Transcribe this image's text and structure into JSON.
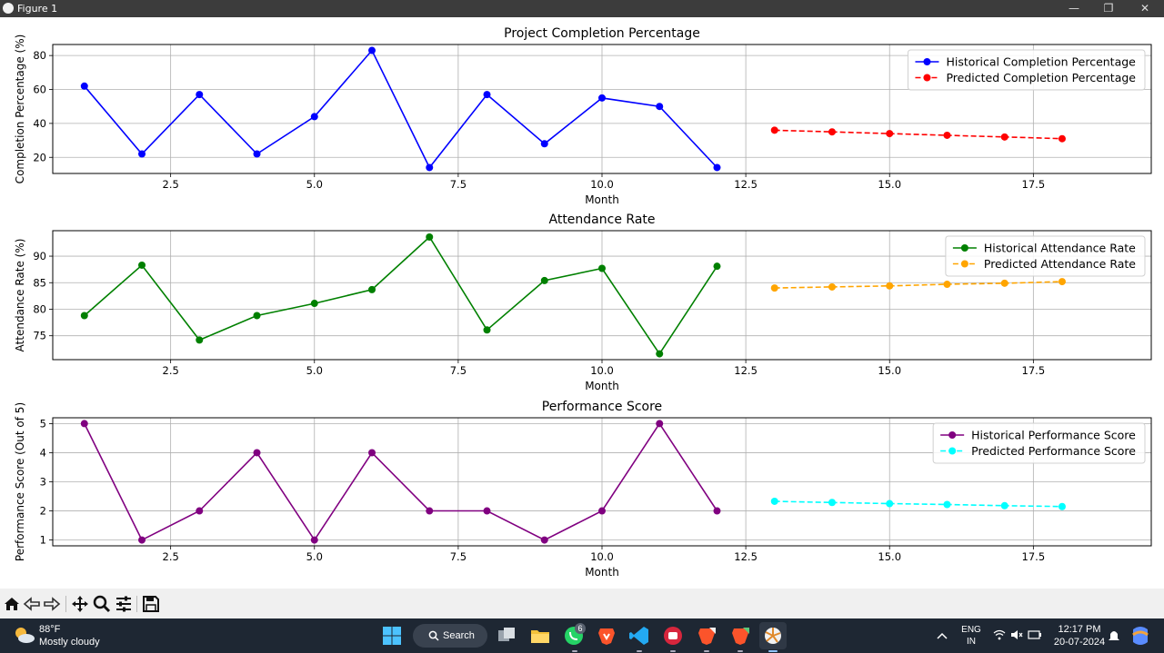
{
  "window": {
    "title": "Figure 1",
    "minimize_glyph": "—",
    "maximize_glyph": "❐",
    "close_glyph": "✕"
  },
  "charts": [
    {
      "title": "Project Completion Percentage",
      "xlabel": "Month",
      "ylabel": "Completion Percentage (%)",
      "xlim": [
        0.45,
        19.55
      ],
      "ylim": [
        10.5,
        86.5
      ],
      "xticks": [
        2.5,
        5.0,
        7.5,
        10.0,
        12.5,
        15.0,
        17.5
      ],
      "xtick_labels": [
        "2.5",
        "5.0",
        "7.5",
        "10.0",
        "12.5",
        "15.0",
        "17.5"
      ],
      "yticks": [
        20,
        40,
        60,
        80
      ],
      "ytick_labels": [
        "20",
        "40",
        "60",
        "80"
      ],
      "legend_position": "upper-right",
      "series": [
        {
          "name": "Historical Completion Percentage",
          "color": "#0000ff",
          "style": "solid",
          "x": [
            1,
            2,
            3,
            4,
            5,
            6,
            7,
            8,
            9,
            10,
            11,
            12
          ],
          "values": [
            62,
            22,
            57,
            22,
            44,
            83,
            14,
            57,
            28,
            55,
            50,
            14
          ]
        },
        {
          "name": "Predicted Completion Percentage",
          "color": "#ff0000",
          "style": "dashed",
          "x": [
            13,
            14,
            15,
            16,
            17,
            18
          ],
          "values": [
            36,
            35,
            34,
            33,
            32,
            31
          ]
        }
      ]
    },
    {
      "title": "Attendance Rate",
      "xlabel": "Month",
      "ylabel": "Attendance Rate (%)",
      "xlim": [
        0.45,
        19.55
      ],
      "ylim": [
        70.5,
        94.8
      ],
      "xticks": [
        2.5,
        5.0,
        7.5,
        10.0,
        12.5,
        15.0,
        17.5
      ],
      "xtick_labels": [
        "2.5",
        "5.0",
        "7.5",
        "10.0",
        "12.5",
        "15.0",
        "17.5"
      ],
      "yticks": [
        75,
        80,
        85,
        90
      ],
      "ytick_labels": [
        "75",
        "80",
        "85",
        "90"
      ],
      "legend_position": "upper-right",
      "series": [
        {
          "name": "Historical Attendance Rate",
          "color": "#008000",
          "style": "solid",
          "x": [
            1,
            2,
            3,
            4,
            5,
            6,
            7,
            8,
            9,
            10,
            11,
            12
          ],
          "values": [
            78.8,
            88.3,
            74.2,
            78.8,
            81.1,
            83.7,
            93.6,
            76.1,
            85.4,
            87.7,
            71.6,
            88.1
          ]
        },
        {
          "name": "Predicted Attendance Rate",
          "color": "#ffa500",
          "style": "dashed",
          "x": [
            13,
            14,
            15,
            16,
            17,
            18
          ],
          "values": [
            84.0,
            84.2,
            84.4,
            84.7,
            84.9,
            85.2
          ]
        }
      ]
    },
    {
      "title": "Performance Score",
      "xlabel": "Month",
      "ylabel": "Performance Score (Out of 5)",
      "xlim": [
        0.45,
        19.55
      ],
      "ylim": [
        0.8,
        5.2
      ],
      "xticks": [
        2.5,
        5.0,
        7.5,
        10.0,
        12.5,
        15.0,
        17.5
      ],
      "xtick_labels": [
        "2.5",
        "5.0",
        "7.5",
        "10.0",
        "12.5",
        "15.0",
        "17.5"
      ],
      "yticks": [
        1,
        2,
        3,
        4,
        5
      ],
      "ytick_labels": [
        "1",
        "2",
        "3",
        "4",
        "5"
      ],
      "legend_position": "upper-right",
      "series": [
        {
          "name": "Historical Performance Score",
          "color": "#800080",
          "style": "solid",
          "x": [
            1,
            2,
            3,
            4,
            5,
            6,
            7,
            8,
            9,
            10,
            11,
            12
          ],
          "values": [
            5,
            1,
            2,
            4,
            1,
            4,
            2,
            2,
            1,
            2,
            5,
            2
          ]
        },
        {
          "name": "Predicted Performance Score",
          "color": "#00ffff",
          "style": "dashed",
          "x": [
            13,
            14,
            15,
            16,
            17,
            18
          ],
          "values": [
            2.33,
            2.29,
            2.25,
            2.22,
            2.18,
            2.15
          ]
        }
      ]
    }
  ],
  "toolbar": {
    "items": [
      "home-icon",
      "back-icon",
      "forward-icon",
      "pan-icon",
      "zoom-icon",
      "configure-subplots-icon",
      "save-icon"
    ]
  },
  "taskbar": {
    "weather_temp": "88°F",
    "weather_condition": "Mostly cloudy",
    "search_label": "Search",
    "whatsapp_badge": "6",
    "lang_top": "ENG",
    "lang_bottom": "IN",
    "time": "12:17 PM",
    "date": "20-07-2024"
  }
}
